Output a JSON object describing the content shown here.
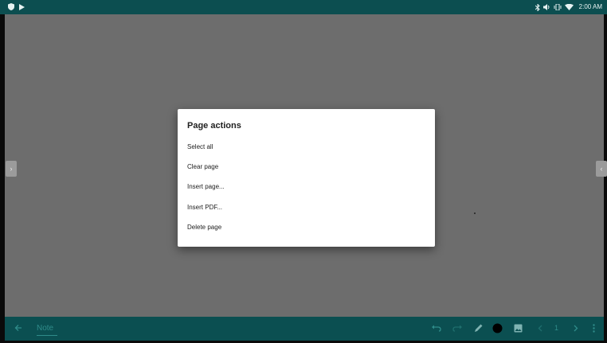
{
  "status_bar": {
    "time": "2:00 AM",
    "icons": [
      "shield-icon",
      "play-store-icon",
      "bluetooth-icon",
      "volume-icon",
      "vibrate-icon",
      "wifi-icon"
    ]
  },
  "dialog": {
    "title": "Page actions",
    "items": [
      {
        "label": "Select all"
      },
      {
        "label": "Clear page"
      },
      {
        "label": "Insert page..."
      },
      {
        "label": "Insert PDF..."
      },
      {
        "label": "Delete page"
      }
    ]
  },
  "navigation": {
    "prev_page_icon": "chevron-right-icon",
    "next_page_icon": "chevron-left-icon"
  },
  "toolbar": {
    "title": "Note",
    "page_number": "1",
    "tools": [
      "back-arrow-icon",
      "undo-icon",
      "redo-icon",
      "pen-icon",
      "color-dot-icon",
      "image-icon",
      "prev-page-icon",
      "next-page-icon",
      "more-icon"
    ],
    "pen_color": "#000000",
    "accent_color": "#2f8c8a"
  },
  "colors": {
    "status_bar": "#0c4e50",
    "toolbar": "#0b4f51",
    "scrim": "#6d6d6d",
    "dialog_bg": "#ffffff"
  }
}
